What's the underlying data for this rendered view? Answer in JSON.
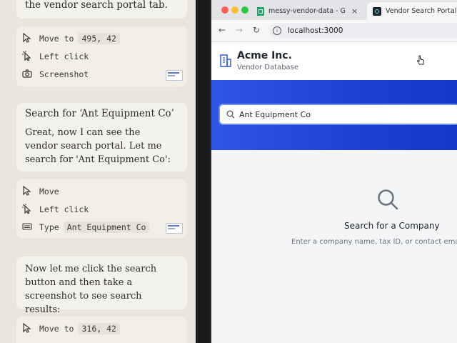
{
  "transcript": {
    "top_text": "the vendor search portal tab.",
    "block1": {
      "rows": [
        {
          "label": "Move to",
          "code": "495, 42"
        },
        {
          "label": "Left click",
          "code": ""
        },
        {
          "label": "Screenshot",
          "code": ""
        }
      ]
    },
    "msg1": {
      "title": "Search for ‘Ant Equipment Co’",
      "body": "Great, now I can see the vendor search portal. Let me search for 'Ant Equipment Co':"
    },
    "block2": {
      "rows": [
        {
          "label": "Move",
          "code": ""
        },
        {
          "label": "Left click",
          "code": ""
        },
        {
          "label": "Type",
          "code": "Ant Equipment Co"
        }
      ]
    },
    "msg2": {
      "body": "Now let me click the search button and then take a screenshot to see search results:"
    },
    "block3": {
      "rows": [
        {
          "label": "Move to",
          "code": "316, 42"
        }
      ]
    }
  },
  "browser": {
    "tabs": [
      {
        "label": "messy-vendor-data - Google",
        "icon": "sheets-icon"
      },
      {
        "label": "Vendor Search Portal",
        "icon": "react-icon"
      }
    ],
    "url": "localhost:3000",
    "app": {
      "company": "Acme Inc.",
      "subtitle": "Vendor Database"
    },
    "search": {
      "value": "Ant Equipment Co"
    },
    "empty_state": {
      "title": "Search for a Company",
      "hint": "Enter a company name, tax ID, or contact email t"
    }
  },
  "colors": {
    "banner": "#2447de",
    "sheets_green": "#1ea362",
    "traffic_red": "#ff5f57",
    "traffic_yellow": "#febc2e",
    "traffic_green": "#28c840"
  }
}
